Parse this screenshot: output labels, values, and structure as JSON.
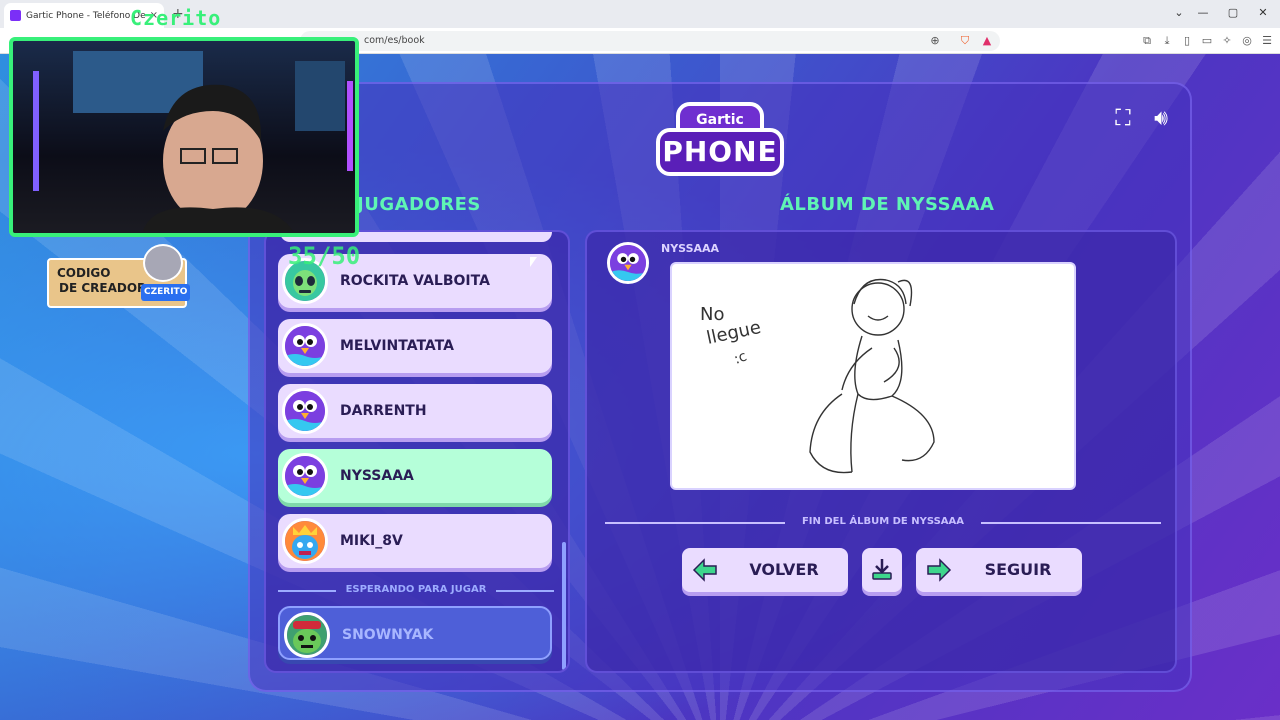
{
  "browser": {
    "tab_title": "Gartic Phone - Teléfono Descon",
    "tab_close": "×",
    "new_tab": "+",
    "url": "com/es/book",
    "window_controls": [
      "⌄",
      "—",
      "▢",
      "✕"
    ]
  },
  "overlay": {
    "cam_title": "Czerito",
    "counter": "35/50",
    "creator_line1": "CODIGO",
    "creator_line2": "DE CREADOR",
    "creator_tag": "CZERITO"
  },
  "logo": {
    "top": "Gartic",
    "bottom": "PHONE"
  },
  "headings": {
    "players": "JUGADORES",
    "album": "ÁLBUM DE NYSSAAA"
  },
  "players": [
    {
      "name": "ROCKITA VALBOITA",
      "avatar": "alien-avatar",
      "state": "normal"
    },
    {
      "name": "MELVINTATATA",
      "avatar": "bird-avatar",
      "state": "normal"
    },
    {
      "name": "DARRENTH",
      "avatar": "bird-avatar",
      "state": "normal"
    },
    {
      "name": "NYSSAAA",
      "avatar": "bird-avatar",
      "state": "active"
    },
    {
      "name": "MIKI_8V",
      "avatar": "king-avatar",
      "state": "normal"
    }
  ],
  "waiting_label": "ESPERANDO PARA JUGAR",
  "waiting_players": [
    {
      "name": "SNOWNYAK",
      "avatar": "creature-avatar"
    }
  ],
  "album": {
    "author": "NYSSAAA",
    "drawing_text_1": "No",
    "drawing_text_2": "llegue",
    "drawing_text_3": ":c",
    "end_label": "FIN DEL ÁLBUM DE NYSSAAA",
    "back_label": "VOLVER",
    "next_label": "SEGUIR"
  },
  "colors": {
    "accent_green": "#5ff5b4",
    "button_bg": "#eadcff",
    "active_row": "#b5ffd9",
    "cam_border": "#38f07a"
  }
}
